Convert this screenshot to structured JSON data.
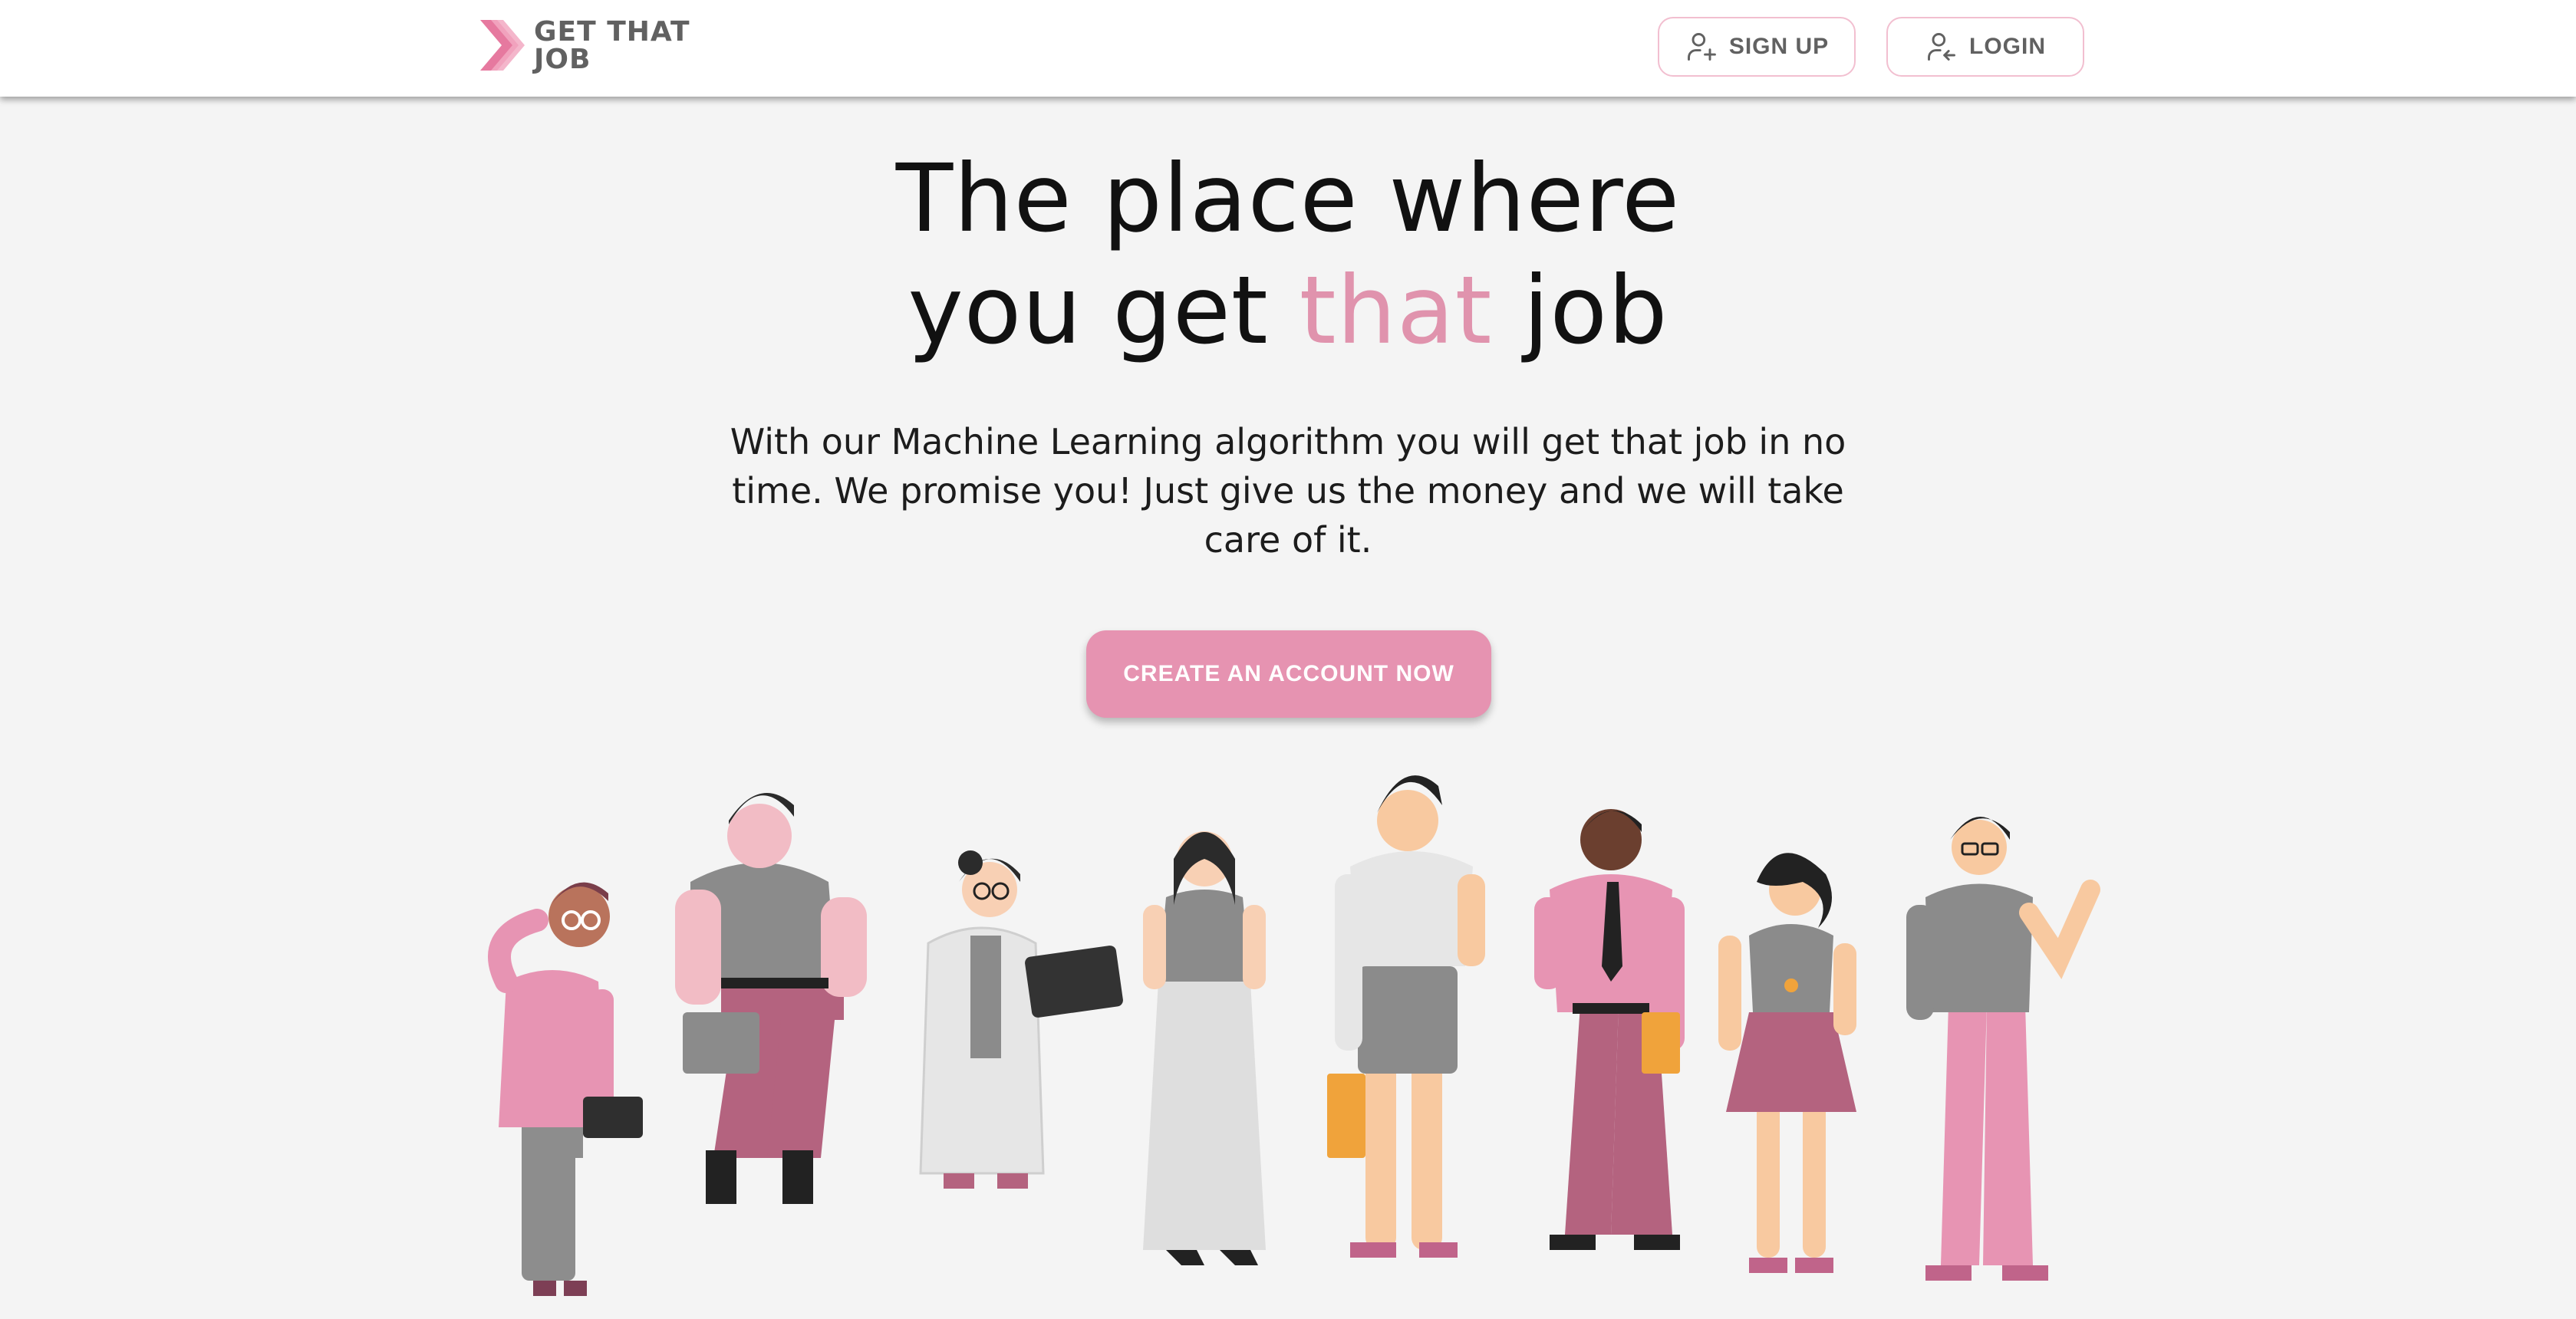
{
  "header": {
    "logo_text": "GET THAT\nJOB",
    "signup_label": "SIGN UP",
    "login_label": "LOGIN"
  },
  "hero": {
    "title_line1": "The place where",
    "title_line2_start": "you get",
    "title_accent": "that",
    "title_line2_end": "job",
    "subtitle": "With our Machine Learning algorithm you will get that job in no time. We promise you! Just give us the money and we will take care of it.",
    "cta_label": "CREATE AN ACCOUNT NOW"
  },
  "colors": {
    "accent": "#e693b1",
    "accent_text": "#e093ad",
    "header_bg": "#ffffff",
    "page_bg": "#f4f4f4",
    "button_border": "#f2bfd0",
    "text_gray": "#616161"
  },
  "icons": {
    "logo": "chevron-logo-icon",
    "signup": "user-plus-icon",
    "login": "user-login-icon"
  }
}
